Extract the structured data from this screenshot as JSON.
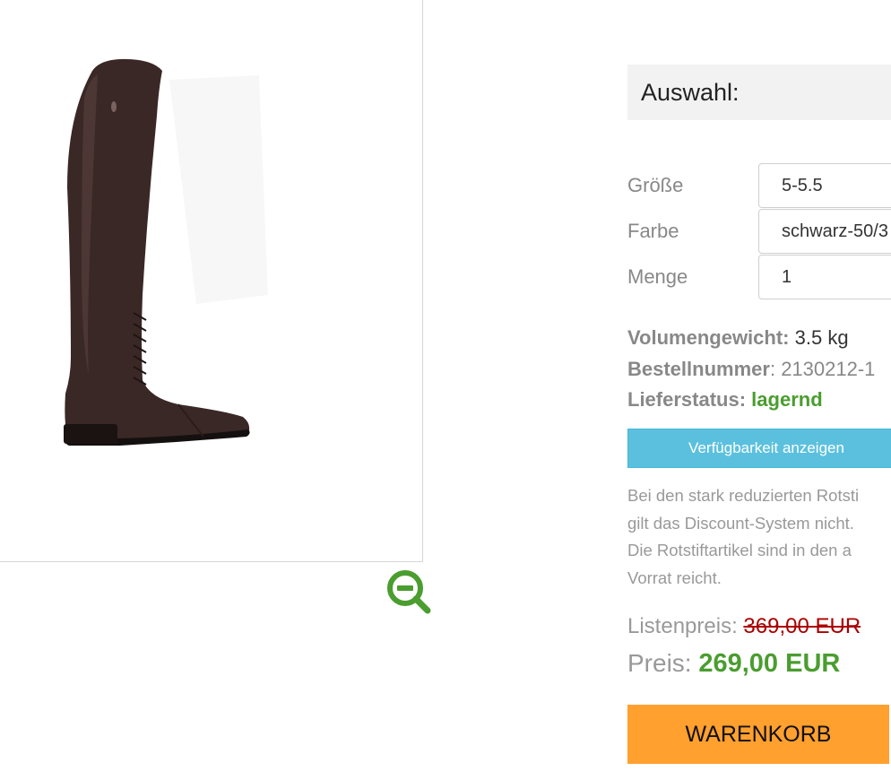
{
  "product": {
    "image_alt": "Reitstiefel",
    "zoom_icon": "zoom-out-icon",
    "colors": {
      "zoom": "#4a9d2f",
      "boot": "#3a2826"
    }
  },
  "selection": {
    "title": "Auswahl:",
    "options": [
      {
        "label": "Größe",
        "value": "5-5.5"
      },
      {
        "label": "Farbe",
        "value": "schwarz-50/3"
      },
      {
        "label": "Menge",
        "value": "1"
      }
    ]
  },
  "details": {
    "weight_key": "Volumengewicht:",
    "weight_val": "3.5 kg",
    "order_key": "Bestellnummer",
    "order_sep": ": ",
    "order_val": "2130212-1",
    "status_key": "Lieferstatus:",
    "status_val": "lagernd"
  },
  "availability_button": "Verfügbarkeit anzeigen",
  "note_lines": [
    "Bei den stark reduzierten Rotsti",
    "gilt das Discount-System nicht.",
    "Die Rotstiftartikel sind in den a",
    "Vorrat reicht."
  ],
  "pricing": {
    "list_label": "Listenpreis: ",
    "list_price": "369,00 EUR",
    "price_label": "Preis: ",
    "price": "269,00 EUR"
  },
  "cart_button": "WARENKORB",
  "colors": {
    "accent_green": "#4a9d2f",
    "info_blue": "#5bc0de",
    "cart_orange": "#ffa02f",
    "strike_red": "#aa0000"
  }
}
